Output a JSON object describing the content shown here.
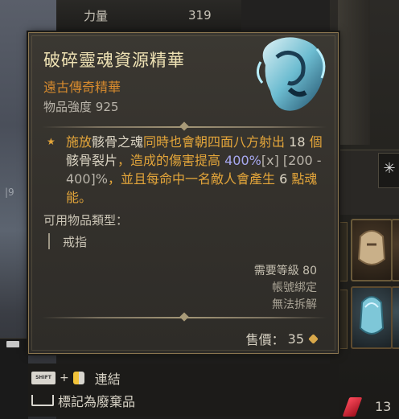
{
  "background": {
    "stat_label": "力量",
    "stat_value": "319",
    "left_mark": "|9",
    "bottom_count": "13"
  },
  "tooltip": {
    "title": "破碎靈魂資源精華",
    "rarity": "遠古傳奇精華",
    "power_label": "物品強度",
    "power_value": "925",
    "affix": {
      "p1": "施放",
      "p2": "骸骨之魂",
      "p3": "同時也會朝四面八方射出",
      "p4": "18",
      "p5": "個",
      "p6": "骸骨裂片",
      "p7": "，造成的傷害提高",
      "p8": "400%",
      "p9": "[x] [200 - 400]%",
      "p10": "，並且每命中一名敵人會產生",
      "p11": "6",
      "p12": "點魂能。"
    },
    "item_types_label": "可用物品類型：",
    "item_type": "戒指",
    "level_req": "需要等級 80",
    "account_bound": "帳號綁定",
    "unsalvageable": "無法拆解",
    "price_label": "售價：",
    "price_value": "35"
  },
  "hints": {
    "shift_key": "SHIFT",
    "compare_label": "連結",
    "mark_junk_label": "標記為廢棄品"
  },
  "colors": {
    "title": "#efe2b4",
    "rarity": "#d68a2e",
    "affix": "#e3a53a",
    "border": "#8b7650"
  },
  "icons": [
    "shift-key-icon",
    "mouse-left-icon",
    "space-key-icon",
    "coin-icon",
    "item-aspect-icon",
    "affix-star-icon"
  ]
}
